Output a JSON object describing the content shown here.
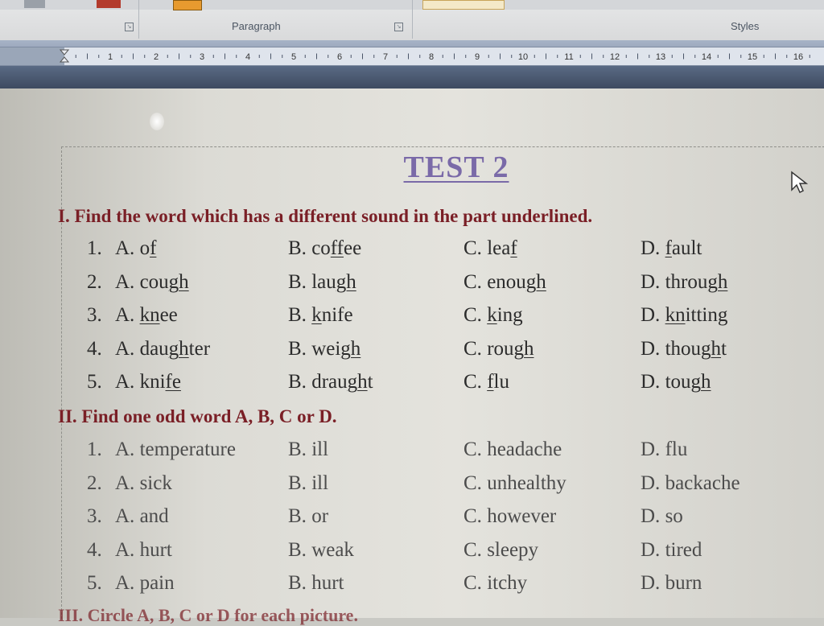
{
  "ribbon": {
    "groups": [
      {
        "label": "Paragraph"
      },
      {
        "label": "Styles"
      }
    ]
  },
  "ruler": {
    "numbers": [
      "1",
      "2",
      "3",
      "4",
      "5",
      "6",
      "7",
      "8",
      "9",
      "10",
      "11",
      "12",
      "13",
      "14",
      "15",
      "16"
    ]
  },
  "document": {
    "title": "TEST 2",
    "sections": [
      {
        "heading": "I. Find the word which has a different sound in the part underlined.",
        "questions": [
          {
            "num": "1.",
            "options": [
              {
                "letter": "A.",
                "pre": "o",
                "u": "f",
                "post": ""
              },
              {
                "letter": "B.",
                "pre": "co",
                "u": "ff",
                "post": "ee"
              },
              {
                "letter": "C.",
                "pre": "lea",
                "u": "f",
                "post": ""
              },
              {
                "letter": "D.",
                "pre": "",
                "u": "f",
                "post": "ault"
              }
            ]
          },
          {
            "num": "2.",
            "options": [
              {
                "letter": "A.",
                "pre": "cou",
                "u": "gh",
                "post": ""
              },
              {
                "letter": "B.",
                "pre": "lau",
                "u": "gh",
                "post": ""
              },
              {
                "letter": "C.",
                "pre": "enou",
                "u": "gh",
                "post": ""
              },
              {
                "letter": "D.",
                "pre": "throu",
                "u": "gh",
                "post": ""
              }
            ]
          },
          {
            "num": "3.",
            "options": [
              {
                "letter": "A.",
                "pre": "",
                "u": "kn",
                "post": "ee"
              },
              {
                "letter": "B.",
                "pre": "",
                "u": "k",
                "post": "nife"
              },
              {
                "letter": "C.",
                "pre": "",
                "u": "k",
                "post": "ing"
              },
              {
                "letter": "D.",
                "pre": "",
                "u": "kn",
                "post": "itting"
              }
            ]
          },
          {
            "num": "4.",
            "options": [
              {
                "letter": "A.",
                "pre": "dau",
                "u": "gh",
                "post": "ter"
              },
              {
                "letter": "B.",
                "pre": "wei",
                "u": "gh",
                "post": ""
              },
              {
                "letter": "C.",
                "pre": "rou",
                "u": "gh",
                "post": ""
              },
              {
                "letter": "D.",
                "pre": "thou",
                "u": "gh",
                "post": "t"
              }
            ]
          },
          {
            "num": "5.",
            "options": [
              {
                "letter": "A.",
                "pre": "kni",
                "u": "fe",
                "post": ""
              },
              {
                "letter": "B.",
                "pre": "drau",
                "u": "gh",
                "post": "t"
              },
              {
                "letter": "C.",
                "pre": "",
                "u": "f",
                "post": "lu"
              },
              {
                "letter": "D.",
                "pre": "tou",
                "u": "gh",
                "post": ""
              }
            ]
          }
        ]
      },
      {
        "heading": "II. Find one odd word A, B, C or D.",
        "questions": [
          {
            "num": "1.",
            "options": [
              {
                "letter": "A.",
                "pre": "temperature",
                "u": "",
                "post": ""
              },
              {
                "letter": "B.",
                "pre": "ill",
                "u": "",
                "post": ""
              },
              {
                "letter": "C.",
                "pre": "headache",
                "u": "",
                "post": ""
              },
              {
                "letter": "D.",
                "pre": "flu",
                "u": "",
                "post": ""
              }
            ]
          },
          {
            "num": "2.",
            "options": [
              {
                "letter": "A.",
                "pre": "sick",
                "u": "",
                "post": ""
              },
              {
                "letter": "B.",
                "pre": "ill",
                "u": "",
                "post": ""
              },
              {
                "letter": "C.",
                "pre": "unhealthy",
                "u": "",
                "post": ""
              },
              {
                "letter": "D.",
                "pre": "backache",
                "u": "",
                "post": ""
              }
            ]
          },
          {
            "num": "3.",
            "options": [
              {
                "letter": "A.",
                "pre": "and",
                "u": "",
                "post": ""
              },
              {
                "letter": "B.",
                "pre": "or",
                "u": "",
                "post": ""
              },
              {
                "letter": "C.",
                "pre": "however",
                "u": "",
                "post": ""
              },
              {
                "letter": "D.",
                "pre": "so",
                "u": "",
                "post": ""
              }
            ]
          },
          {
            "num": "4.",
            "options": [
              {
                "letter": "A.",
                "pre": "hurt",
                "u": "",
                "post": ""
              },
              {
                "letter": "B.",
                "pre": "weak",
                "u": "",
                "post": ""
              },
              {
                "letter": "C.",
                "pre": "sleepy",
                "u": "",
                "post": ""
              },
              {
                "letter": "D.",
                "pre": "tired",
                "u": "",
                "post": ""
              }
            ]
          },
          {
            "num": "5.",
            "options": [
              {
                "letter": "A.",
                "pre": "pain",
                "u": "",
                "post": ""
              },
              {
                "letter": "B.",
                "pre": "hurt",
                "u": "",
                "post": ""
              },
              {
                "letter": "C.",
                "pre": "itchy",
                "u": "",
                "post": ""
              },
              {
                "letter": "D.",
                "pre": "burn",
                "u": "",
                "post": ""
              }
            ]
          }
        ]
      }
    ],
    "next_heading_partial": "III. Circle A, B, C or D for each picture."
  },
  "colors": {
    "title": "#7a6aa8",
    "heading": "#7a1f26",
    "body_text": "#2c2c2c"
  }
}
